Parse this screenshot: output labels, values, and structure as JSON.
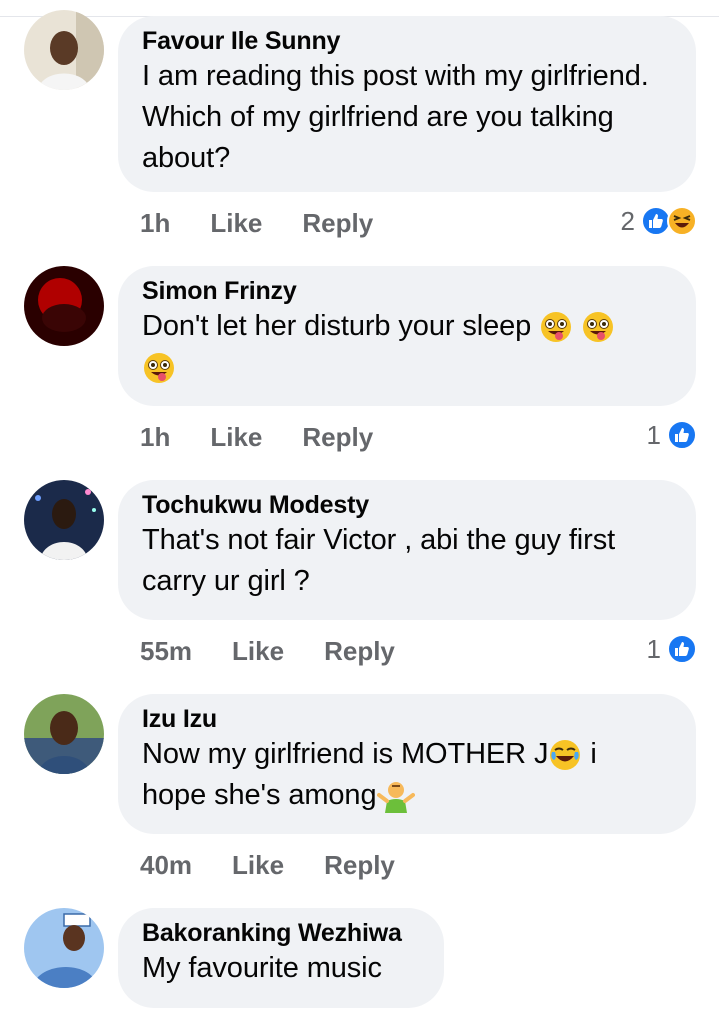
{
  "comments": [
    {
      "author": "Favour Ile Sunny",
      "text": "I am reading this post with my girlfriend. Which of my girlfriend are you talking about?",
      "time": "1h",
      "like": "Like",
      "reply": "Reply",
      "reaction_count": "2",
      "reactions": [
        "like-icon",
        "haha-icon"
      ]
    },
    {
      "author": "Simon Frinzy",
      "text": "Don't let her disturb your sleep",
      "time": "1h",
      "like": "Like",
      "reply": "Reply",
      "reaction_count": "1",
      "reactions": [
        "like-icon"
      ]
    },
    {
      "author": "Tochukwu Modesty",
      "text": "That's not fair Victor , abi the guy first carry ur girl ?",
      "time": "55m",
      "like": "Like",
      "reply": "Reply",
      "reaction_count": "1",
      "reactions": [
        "like-icon"
      ]
    },
    {
      "author": "Izu Izu",
      "text_line1": "Now my girlfriend is MOTHER J",
      "text_line1b": " i",
      "text_line2": "hope she's among",
      "time": "40m",
      "like": "Like",
      "reply": "Reply"
    },
    {
      "author": "Bakoranking Wezhiwa",
      "text": "My favourite music"
    }
  ],
  "colors": {
    "bubble": "#f0f2f5",
    "meta": "#65676b",
    "like_blue": "#1877f2"
  }
}
